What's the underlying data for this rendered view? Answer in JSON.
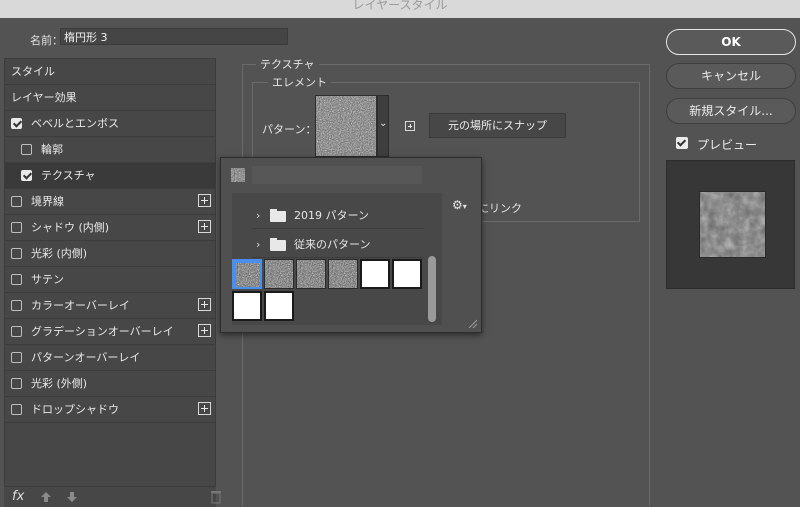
{
  "window": {
    "title": "レイヤースタイル"
  },
  "name_field": {
    "label": "名前：",
    "value": "楕円形 3"
  },
  "styles_panel": {
    "items": [
      {
        "label": "スタイル",
        "type": "header"
      },
      {
        "label": "レイヤー効果",
        "type": "header"
      },
      {
        "label": "ベベルとエンボス",
        "checked": true,
        "indent": 0,
        "plus": false,
        "selected": false
      },
      {
        "label": "輪郭",
        "checked": false,
        "indent": 1,
        "plus": false,
        "selected": false
      },
      {
        "label": "テクスチャ",
        "checked": true,
        "indent": 1,
        "plus": false,
        "selected": true
      },
      {
        "label": "境界線",
        "checked": false,
        "indent": 0,
        "plus": true,
        "selected": false
      },
      {
        "label": "シャドウ (内側)",
        "checked": false,
        "indent": 0,
        "plus": true,
        "selected": false
      },
      {
        "label": "光彩 (内側)",
        "checked": false,
        "indent": 0,
        "plus": false,
        "selected": false
      },
      {
        "label": "サテン",
        "checked": false,
        "indent": 0,
        "plus": false,
        "selected": false
      },
      {
        "label": "カラーオーバーレイ",
        "checked": false,
        "indent": 0,
        "plus": true,
        "selected": false
      },
      {
        "label": "グラデーションオーバーレイ",
        "checked": false,
        "indent": 0,
        "plus": true,
        "selected": false
      },
      {
        "label": "パターンオーバーレイ",
        "checked": false,
        "indent": 0,
        "plus": false,
        "selected": false
      },
      {
        "label": "光彩 (外側)",
        "checked": false,
        "indent": 0,
        "plus": false,
        "selected": false
      },
      {
        "label": "ドロップシャドウ",
        "checked": false,
        "indent": 0,
        "plus": true,
        "selected": false
      }
    ],
    "fx_label": "fx"
  },
  "texture_group": {
    "title": "テクスチャ",
    "element_title": "エレメント",
    "pattern_label": "パターン：",
    "snap_button": "元の場所にスナップ",
    "link_label": "にリンク"
  },
  "pattern_picker": {
    "folders": [
      {
        "label": "2019 パターン"
      },
      {
        "label": "従来のパターン"
      }
    ],
    "thumbnails": [
      {
        "kind": "noise",
        "selected": true
      },
      {
        "kind": "noise",
        "selected": false
      },
      {
        "kind": "noise",
        "selected": false
      },
      {
        "kind": "noise",
        "selected": false
      },
      {
        "kind": "white",
        "selected": false
      },
      {
        "kind": "white",
        "selected": false
      },
      {
        "kind": "white",
        "selected": false
      },
      {
        "kind": "white",
        "selected": false
      }
    ]
  },
  "actions": {
    "ok": "OK",
    "cancel": "キャンセル",
    "new_style": "新規スタイル...",
    "preview_label": "プレビュー",
    "preview_checked": true
  },
  "colors": {
    "background": "#535353",
    "panel": "#474747",
    "selection": "#4a8ff0"
  }
}
